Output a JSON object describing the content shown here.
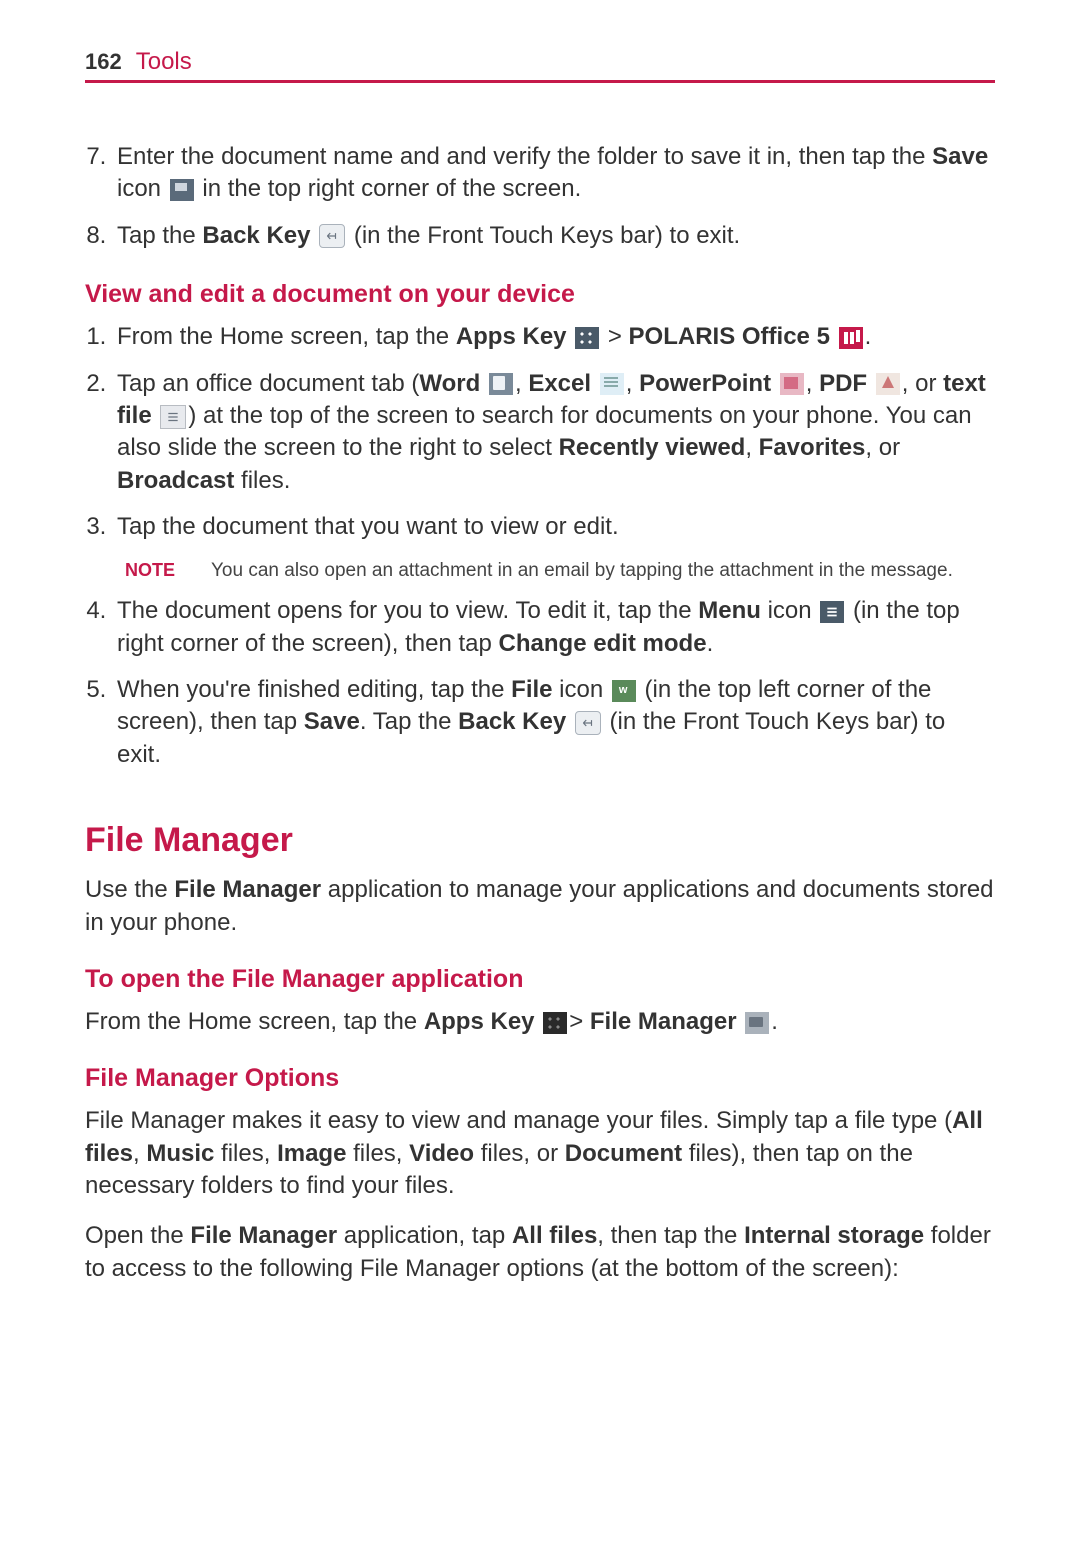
{
  "header": {
    "pageNumber": "162",
    "section": "Tools"
  },
  "steps_a": {
    "start": 7,
    "items": [
      {
        "pre": "Enter the document name and and verify the folder to save it in, then tap the ",
        "bold1": "Save",
        "mid": " icon ",
        "icon": "save-icon",
        "post": " in the top right corner of the screen."
      },
      {
        "pre": "Tap the ",
        "bold1": "Back Key",
        "mid": " ",
        "icon": "back-icon",
        "post": " (in the Front Touch Keys bar) to exit."
      }
    ]
  },
  "subhead1": "View and edit a document on your device",
  "steps_b": {
    "start": 1,
    "item1": {
      "pre": "From the Home screen, tap the ",
      "b1": "Apps Key",
      "gt": " > ",
      "b2": "POLARIS Office 5",
      "end": "."
    },
    "item2": {
      "pre": "Tap an office document tab (",
      "b_word": "Word",
      "c1": ", ",
      "b_excel": "Excel",
      "c2": ", ",
      "b_ppt": "PowerPoint",
      "c3": ", ",
      "b_pdf": "PDF",
      "c4": ", or ",
      "b_text": "text file",
      "mid": ") at the top of the screen to search for documents on your phone. You can also slide the screen to the right to select ",
      "b_recent": "Recently viewed",
      "c5": ", ",
      "b_fav": "Favorites",
      "c6": ", or ",
      "b_broad": "Broadcast",
      "end": " files."
    },
    "item3": "Tap the document that you want to view or edit.",
    "note_label": "NOTE",
    "note_text": "You can also open an attachment in an email by tapping the attachment in the message.",
    "item4": {
      "pre": "The document opens for you to view. To edit it, tap the ",
      "b_menu": "Menu",
      "mid1": " icon ",
      "mid2": " (in the top right corner of the screen), then tap ",
      "b_change": "Change edit mode",
      "end": "."
    },
    "item5": {
      "pre": "When you're finished editing, tap the ",
      "b_file": "File",
      "mid1": " icon ",
      "mid2": " (in the top left corner of the screen), then tap ",
      "b_save": "Save",
      "mid3": ". Tap the ",
      "b_back": "Back Key",
      "mid4": " ",
      "end": " (in the Front Touch Keys bar) to exit."
    }
  },
  "section2": {
    "title": "File Manager",
    "intro_pre": "Use the ",
    "intro_b": "File Manager",
    "intro_post": " application to manage your applications and documents stored in your phone."
  },
  "subhead2": "To open the File Manager application",
  "open_fm": {
    "pre": "From the Home screen, tap the ",
    "b1": "Apps Key",
    "gt": "> ",
    "b2": "File Manager",
    "end": "."
  },
  "subhead3": "File Manager Options",
  "fm_options": {
    "p1_pre": "File Manager makes it easy to view and manage your files. Simply tap a file type (",
    "b_all": "All files",
    "c1": ", ",
    "b_music": "Music",
    "t_music": " files, ",
    "b_image": "Image",
    "t_image": " files, ",
    "b_video": "Video",
    "t_video": " files, or ",
    "b_doc": "Document",
    "t_doc": " files), then tap on the necessary folders to find your files.",
    "p2_pre": "Open the ",
    "b_fm": "File Manager",
    "p2_mid1": " application, tap ",
    "b_all2": "All files",
    "p2_mid2": ", then tap the ",
    "b_internal": "Internal storage",
    "p2_end": " folder to access to the following File Manager options (at the bottom of the screen):"
  }
}
